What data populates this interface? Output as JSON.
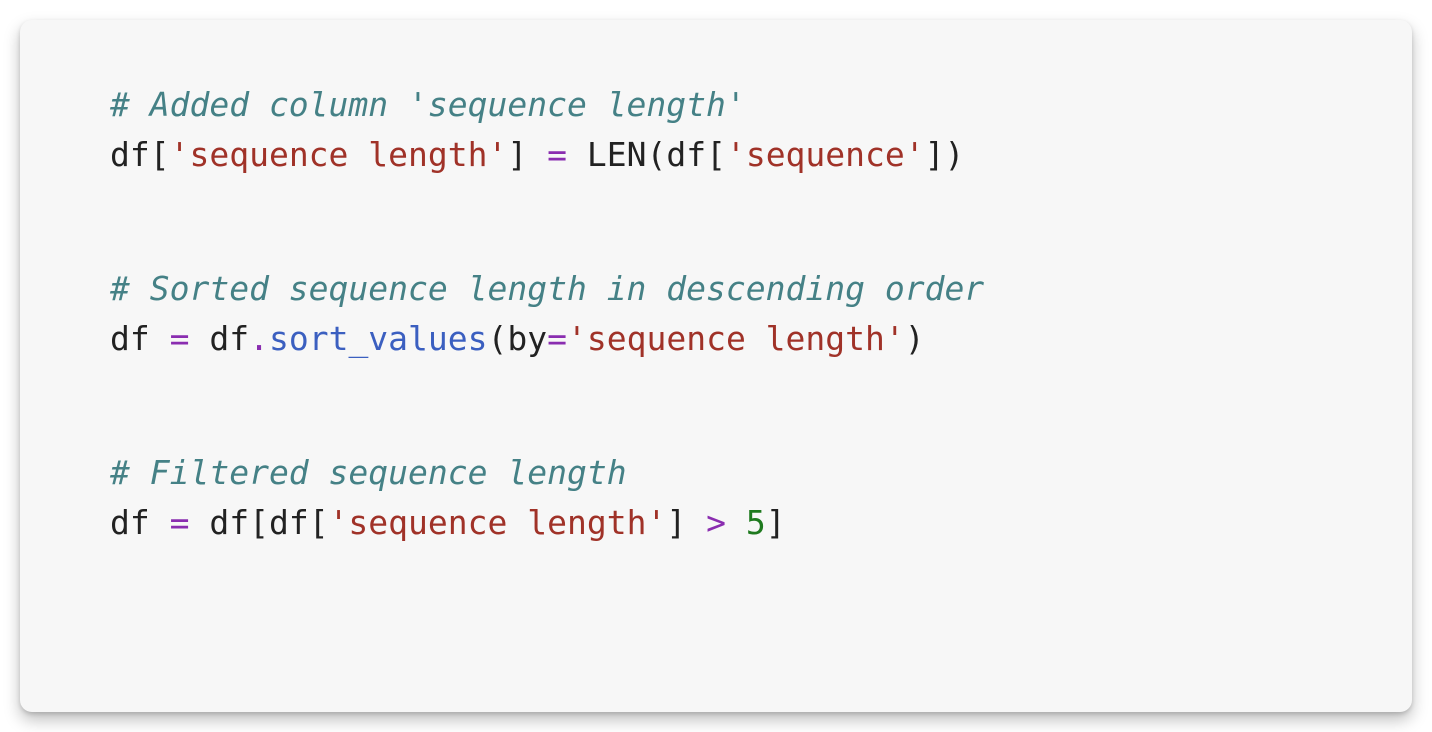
{
  "code": {
    "block1": {
      "comment": "# Added column 'sequence length'",
      "line1": {
        "p1": "df[",
        "p2": "'sequence length'",
        "p3": "] ",
        "p4": "=",
        "p5": " LEN(df[",
        "p6": "'sequence'",
        "p7": "])"
      }
    },
    "block2": {
      "comment": "# Sorted sequence length in descending order",
      "line1": {
        "p1": "df ",
        "p2": "=",
        "p3": " df",
        "p4": ".",
        "p5": "sort_values",
        "p6": "(by",
        "p7": "=",
        "p8": "'sequence length'",
        "p9": ")"
      }
    },
    "block3": {
      "comment": "# Filtered sequence length",
      "line1": {
        "p1": "df ",
        "p2": "=",
        "p3": " df[df[",
        "p4": "'sequence length'",
        "p5": "] ",
        "p6": ">",
        "p7": " ",
        "p8": "5",
        "p9": "]"
      }
    }
  }
}
